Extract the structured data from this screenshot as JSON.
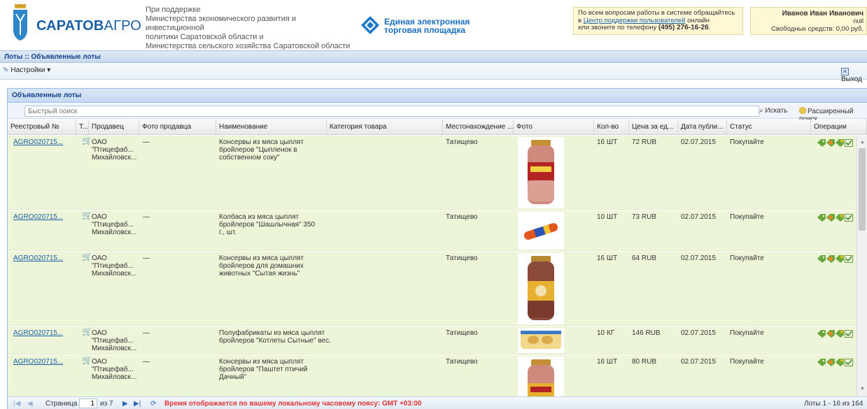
{
  "header": {
    "logo_text_bold": "САРАТОВ",
    "logo_text_thin": "АГРО",
    "support_lines": [
      "При поддержке",
      "Министерства экономического развития и инвестиционной",
      "политики Саратовской области и",
      "Министерства сельского хозяйства Саратовской области"
    ],
    "etp_line1": "Единая электронная",
    "etp_line2": "торговая площадка",
    "help": {
      "line1": "По всем вопросам работы в системе обращайтесь",
      "prefix": "в ",
      "link": "Центр поддержки пользователей",
      "suffix": " онлайн",
      "line3": "или звоните по телефону ",
      "phone": "(495) 276-16-26",
      "phone_suffix": "."
    },
    "user": {
      "name": "Иванов Иван Иванович",
      "org": "null",
      "funds": "Свободных средств: 0,00 руб."
    }
  },
  "breadcrumb": "Лоты :: Объявленные лоты",
  "toolbar": {
    "settings": "Настройки ▾",
    "exit": "Выход"
  },
  "panel": {
    "title": "Объявленные лоты",
    "search_placeholder": "Быстрый поиск",
    "search_btn": "Искать",
    "advanced_btn": "Расширенный поиск"
  },
  "columns": [
    "Реестровый №",
    "Т...",
    "Продавец",
    "Фото продавца",
    "Наименование",
    "Категория товара",
    "Местонахождение ...",
    "Фото",
    "Кол-во",
    "Цена за ед...",
    "Дата публи...",
    "Статус",
    "Операции"
  ],
  "rows": [
    {
      "reg": "AGRO020715...",
      "seller": [
        "ОАО",
        "\"Птицефаб...",
        "Михайловск..."
      ],
      "seller_photo": "—",
      "name": [
        "Консервы из мяса цыплят",
        "бройлеров \"Цыпленок в",
        "собственном соку\""
      ],
      "category": "",
      "location": "Татищево",
      "photo": "jar-red",
      "qty": "16 ШТ",
      "price": "72 RUB",
      "date": "02.07.2015",
      "status": "Покупайте"
    },
    {
      "reg": "AGRO020715...",
      "seller": [
        "ОАО",
        "\"Птицефаб...",
        "Михайловск..."
      ],
      "seller_photo": "—",
      "name": [
        "Колбаса из мяса цыплят",
        "бройлеров \"Шашлычная\" 350",
        "г., шт."
      ],
      "category": "",
      "location": "Татищево",
      "photo": "sausage",
      "qty": "10 ШТ",
      "price": "73 RUB",
      "date": "02.07.2015",
      "status": "Покупайте"
    },
    {
      "reg": "AGRO020715...",
      "seller": [
        "ОАО",
        "\"Птицефаб...",
        "Михайловск..."
      ],
      "seller_photo": "—",
      "name": [
        "Консервы из мяса цыплят",
        "бройлеров для домашних",
        "животных \"Сытая жизнь\""
      ],
      "category": "",
      "location": "Татищево",
      "photo": "jar-brown",
      "qty": "16 ШТ",
      "price": "64 RUB",
      "date": "02.07.2015",
      "status": "Покупайте"
    },
    {
      "reg": "AGRO020715...",
      "seller": [
        "ОАО",
        "\"Птицефаб...",
        "Михайловск..."
      ],
      "seller_photo": "—",
      "name": [
        "Полуфабрикаты из мяса цыплят",
        "бройлеров \"Котлеты Сытные\" вес.",
        ""
      ],
      "category": "",
      "location": "Татищево",
      "photo": "pack",
      "qty": "10 КГ",
      "price": "146 RUB",
      "date": "02.07.2015",
      "status": "Покупайте"
    },
    {
      "reg": "AGRO020715...",
      "seller": [
        "ОАО",
        "\"Птицефаб...",
        "Михайловск..."
      ],
      "seller_photo": "—",
      "name": [
        "Консервы из мяса цыплят",
        "бройлеров \"Паштет птичий",
        "Дачный\""
      ],
      "category": "",
      "location": "Татищево",
      "photo": "jar-red",
      "qty": "16 ШТ",
      "price": "80 RUB",
      "date": "02.07.2015",
      "status": "Покупайте"
    }
  ],
  "pager": {
    "page_label": "Страница",
    "page_value": "1",
    "of_label": "из 7",
    "timezone": "Время отображается по вашему локальному часовому поясу: GMT +03:00",
    "summary": "Лоты 1 - 16 из 164"
  },
  "colors": {
    "row_bg": "#ecf5d8",
    "link": "#1b5fa6",
    "header_blue": "#15428b"
  }
}
